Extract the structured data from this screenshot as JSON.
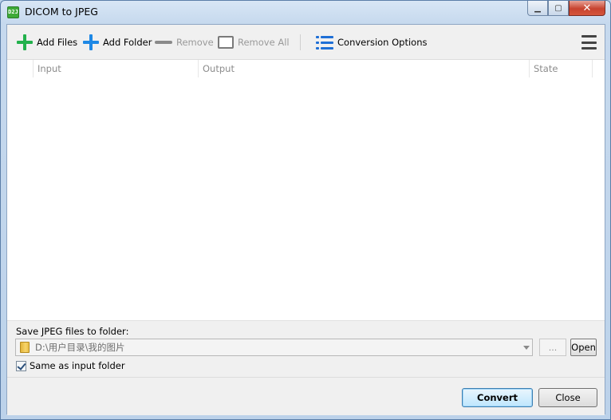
{
  "window": {
    "title": "DICOM to JPEG",
    "icon_text": "D2J",
    "controls": {
      "minimize": "▁",
      "maximize": "▢",
      "close": "✕"
    }
  },
  "toolbar": {
    "add_files": "Add Files",
    "add_folder": "Add Folder",
    "remove": "Remove",
    "remove_all": "Remove All",
    "conversion_options": "Conversion Options",
    "menu_icon": "hamburger-menu-icon"
  },
  "file_list": {
    "columns": [
      "Input",
      "Output",
      "State"
    ],
    "rows": []
  },
  "output": {
    "save_label": "Save JPEG files to folder:",
    "folder_path": "D:\\用户目录\\我的图片",
    "browse_label": "...",
    "open_label": "Open",
    "same_as_input_label": "Same as input folder",
    "same_as_input_checked": true
  },
  "footer": {
    "convert_label": "Convert",
    "close_label": "Close"
  },
  "colors": {
    "add_files_icon": "#22b14c",
    "add_folder_icon": "#1e88e5",
    "options_icon": "#1e6fd6",
    "disabled_text": "#9a9a9a"
  }
}
